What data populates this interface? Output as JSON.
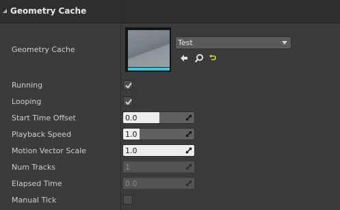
{
  "section": {
    "title": "Geometry Cache"
  },
  "geometry_cache": {
    "label": "Geometry Cache",
    "asset": "Test",
    "icons": [
      "use-selected-arrow-icon",
      "browse-search-icon",
      "reset-to-default-icon"
    ]
  },
  "properties": {
    "running": {
      "label": "Running",
      "checked": true
    },
    "looping": {
      "label": "Looping",
      "checked": true
    },
    "start_time_offset": {
      "label": "Start Time Offset",
      "value": "0.0"
    },
    "playback_speed": {
      "label": "Playback Speed",
      "value": "1.0"
    },
    "motion_vector_scale": {
      "label": "Motion Vector Scale",
      "value": "1.0"
    },
    "num_tracks": {
      "label": "Num Tracks",
      "value": "1"
    },
    "elapsed_time": {
      "label": "Elapsed Time",
      "value": "0.0"
    },
    "manual_tick": {
      "label": "Manual Tick",
      "checked": false
    }
  },
  "colors": {
    "panel_bg": "#3b3b3b",
    "header_bg": "#2f2f2f",
    "thumbnail_accent": "#1fd6e6",
    "reset_icon": "#e3e02a"
  }
}
